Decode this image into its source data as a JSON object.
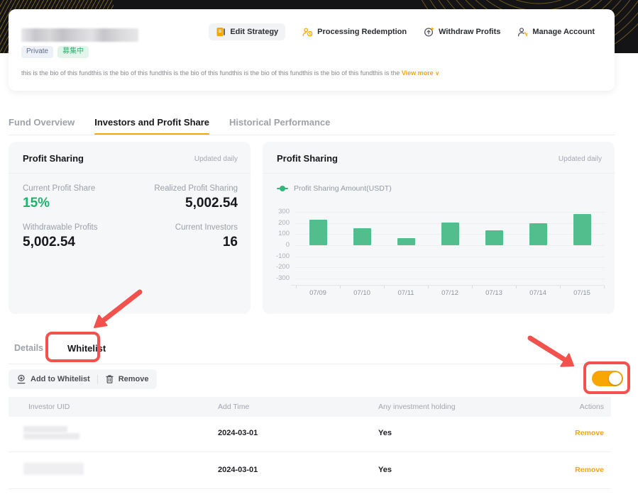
{
  "colors": {
    "accent": "#f7a600",
    "green": "#20b26c",
    "bar_green": "#52be8e",
    "annotation_red": "#f2524d"
  },
  "header": {
    "badges": [
      {
        "label": "Private"
      },
      {
        "label": "募集中"
      }
    ],
    "bio": "this is the bio of this fundthis is the bio of this fundthis is the bio of this fundthis is the bio of this fundthis is the bio of this fundthis is the",
    "view_more": "View more",
    "actions": [
      {
        "label": "Edit Strategy"
      },
      {
        "label": "Processing Redemption"
      },
      {
        "label": "Withdraw Profits"
      },
      {
        "label": "Manage Account"
      }
    ]
  },
  "tabs": [
    {
      "label": "Fund Overview",
      "active": false
    },
    {
      "label": "Investors and Profit Share",
      "active": true
    },
    {
      "label": "Historical Performance",
      "active": false
    }
  ],
  "profit_card": {
    "title": "Profit Sharing",
    "updated": "Updated daily",
    "stats": [
      {
        "label": "Current Profit Share",
        "value": "15%"
      },
      {
        "label": "Realized Profit Sharing",
        "value": "5,002.54"
      },
      {
        "label": "Withdrawable Profits",
        "value": "5,002.54"
      },
      {
        "label": "Current Investors",
        "value": "16"
      }
    ]
  },
  "chart_card": {
    "title": "Profit Sharing",
    "updated": "Updated daily"
  },
  "chart_data": {
    "type": "bar",
    "title": "Profit Sharing",
    "legend": [
      "Profit Sharing Amount(USDT)"
    ],
    "legend_position": "top-left",
    "categories": [
      "07/09",
      "07/10",
      "07/11",
      "07/12",
      "07/13",
      "07/14",
      "07/15"
    ],
    "values": [
      230,
      150,
      65,
      205,
      135,
      195,
      280
    ],
    "xlabel": "",
    "ylabel": "",
    "ylim": [
      -300,
      300
    ],
    "yticks": [
      300,
      200,
      100,
      0,
      -100,
      -200,
      -300
    ],
    "grid": true,
    "bar_color": "#52be8e"
  },
  "sub_tabs": [
    {
      "label": "Details",
      "active": false
    },
    {
      "label": "Whitelist",
      "active": true
    }
  ],
  "toolbar": {
    "add_label": "Add to Whitelist",
    "remove_label": "Remove"
  },
  "whitelist_toggle": {
    "state": "on"
  },
  "table": {
    "columns": [
      "Investor UID",
      "Add Time",
      "Any investment holding",
      "Actions"
    ],
    "rows": [
      {
        "add_time": "2024-03-01",
        "holding": "Yes",
        "action": "Remove"
      },
      {
        "add_time": "2024-03-01",
        "holding": "Yes",
        "action": "Remove"
      }
    ]
  }
}
